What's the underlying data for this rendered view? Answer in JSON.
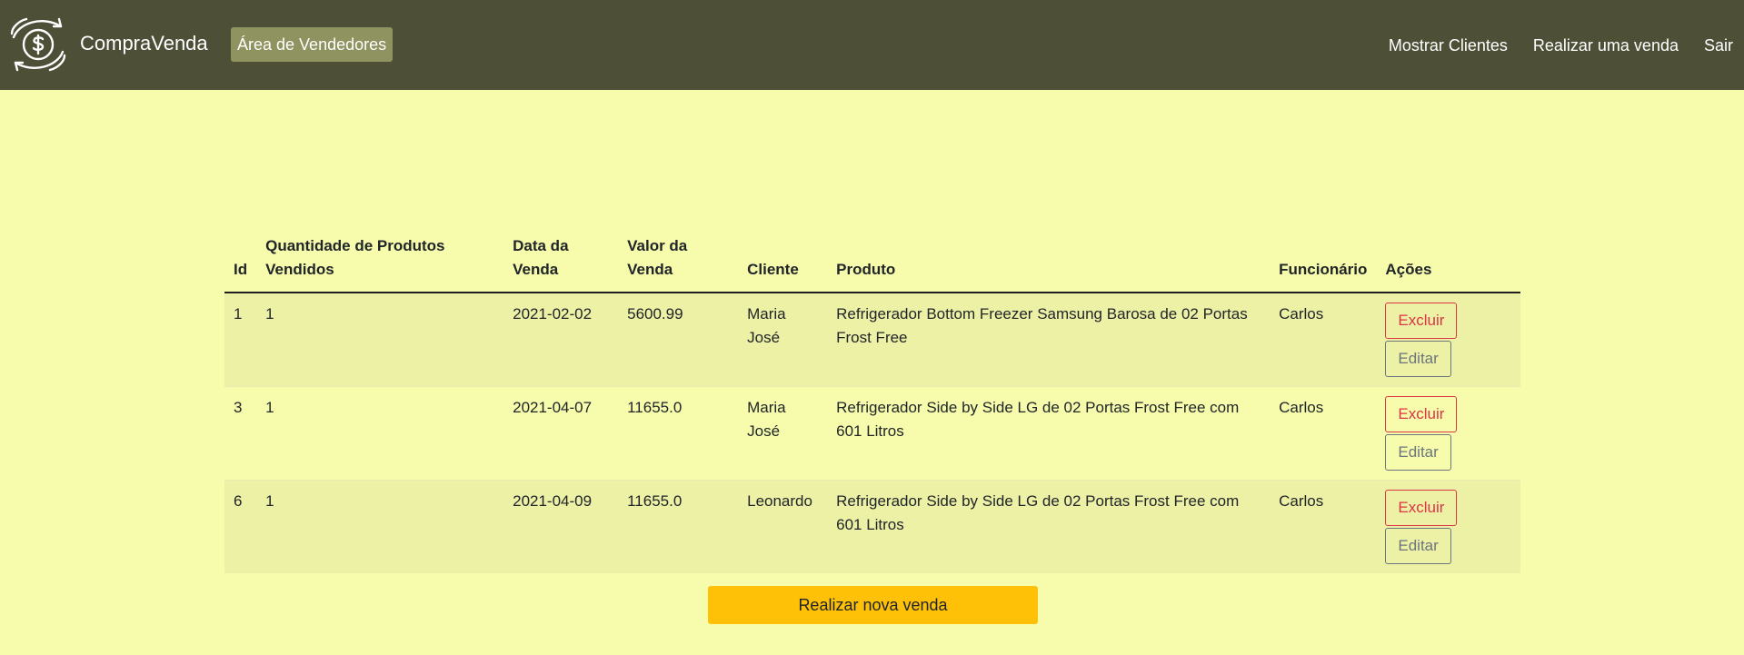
{
  "brand": {
    "name": "CompraVenda",
    "logo_icon": "money-exchange-icon"
  },
  "nav": {
    "area_label": "Área de Vendedores",
    "links": [
      "Mostrar Clientes",
      "Realizar uma venda",
      "Sair"
    ]
  },
  "table": {
    "headers": {
      "id": "Id",
      "qty": "Quantidade de Produtos Vendidos",
      "date": "Data da Venda",
      "value": "Valor da Venda",
      "client": "Cliente",
      "product": "Produto",
      "employee": "Funcionário",
      "actions": "Ações"
    },
    "rows": [
      {
        "id": "1",
        "qty": "1",
        "date": "2021-02-02",
        "value": "5600.99",
        "client": "Maria José",
        "product": "Refrigerador Bottom Freezer Samsung Barosa de 02 Portas Frost Free",
        "employee": "Carlos",
        "delete_label": "Excluir",
        "edit_label": "Editar"
      },
      {
        "id": "3",
        "qty": "1",
        "date": "2021-04-07",
        "value": "11655.0",
        "client": "Maria José",
        "product": "Refrigerador Side by Side LG de 02 Portas Frost Free com 601 Litros",
        "employee": "Carlos",
        "delete_label": "Excluir",
        "edit_label": "Editar"
      },
      {
        "id": "6",
        "qty": "1",
        "date": "2021-04-09",
        "value": "11655.0",
        "client": "Leonardo",
        "product": "Refrigerador Side by Side LG de 02 Portas Frost Free com 601 Litros",
        "employee": "Carlos",
        "delete_label": "Excluir",
        "edit_label": "Editar"
      }
    ]
  },
  "new_sale_label": "Realizar nova venda",
  "colors": {
    "navbar": "#4d5037",
    "background": "#f6fcab",
    "area_button": "#8f9360",
    "striped_row": "#edf1a5",
    "danger": "#dc3545",
    "secondary": "#6c757d",
    "warning": "#ffc107"
  }
}
